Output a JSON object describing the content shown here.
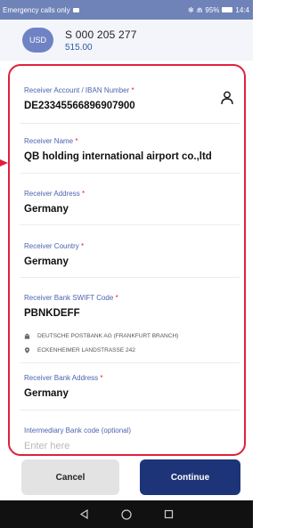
{
  "status_bar": {
    "left_text": "Emergency calls only",
    "right_text": "95%",
    "time": "14:4"
  },
  "account": {
    "currency": "USD",
    "number": "S 000 205 277",
    "balance": "515.00"
  },
  "fields": {
    "account": {
      "label": "Receiver Account / IBAN Number",
      "required": "*",
      "value": "DE23345566896907900"
    },
    "name": {
      "label": "Receiver Name",
      "required": "*",
      "value": "QB holding international airport co.,ltd"
    },
    "address": {
      "label": "Receiver Address",
      "required": "*",
      "value": "Germany"
    },
    "country": {
      "label": "Receiver Country",
      "required": "*",
      "value": "Germany"
    },
    "swift": {
      "label": "Receiver Bank SWIFT Code",
      "required": "*",
      "value": "PBNKDEFF"
    },
    "bank_address": {
      "label": "Receiver Bank Address",
      "required": "*",
      "value": "Germany"
    },
    "intermediary": {
      "label": "Intermediary Bank code (optional)",
      "placeholder": "Enter here"
    }
  },
  "bank_info": {
    "bank_name": "DEUTSCHE POSTBANK AG (FRANKFURT BRANCH)",
    "bank_street": "ECKENHEIMER LANDSTRASSE 242"
  },
  "buttons": {
    "cancel": "Cancel",
    "continue": "Continue"
  },
  "colors": {
    "accent": "#1d3478",
    "label": "#4d62b0",
    "highlight": "#e0203c"
  },
  "icons": [
    "person-icon",
    "bank-icon",
    "location-pin-icon",
    "back-icon",
    "home-icon",
    "recents-icon"
  ]
}
